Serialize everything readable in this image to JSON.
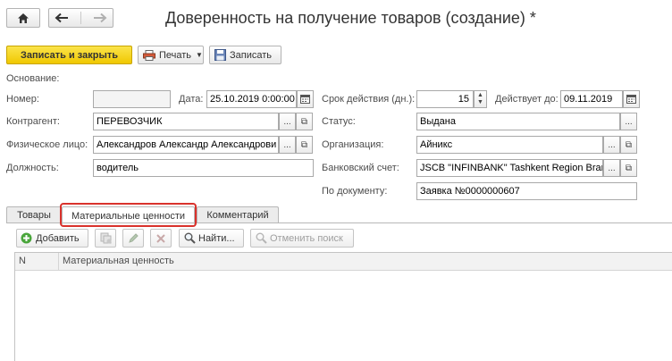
{
  "window": {
    "title": "Доверенность на получение товаров (создание) *"
  },
  "toolbar": {
    "save_close_label": "Записать и закрыть",
    "print_label": "Печать",
    "save_label": "Записать"
  },
  "form": {
    "basis_label": "Основание:",
    "number_label": "Номер:",
    "number_value": "",
    "date_label": "Дата:",
    "date_value": "25.10.2019  0:00:00",
    "validity_label": "Срок действия (дн.):",
    "validity_value": "15",
    "valid_until_label": "Действует до:",
    "valid_until_value": "09.11.2019",
    "counterparty_label": "Контрагент:",
    "counterparty_value": "ПЕРЕВОЗЧИК",
    "status_label": "Статус:",
    "status_value": "Выдана",
    "person_label": "Физическое лицо:",
    "person_value": "Александров Александр Александрови",
    "organization_label": "Организация:",
    "organization_value": "Айникс",
    "position_label": "Должность:",
    "position_value": "водитель",
    "bank_account_label": "Банковский счет:",
    "bank_account_value": "JSCB \"INFINBANK\" Tashkent Region Brar",
    "document_label": "По документу:",
    "document_value": "Заявка №0000000607",
    "ellipsis": "...",
    "open_glyph": "⧉"
  },
  "tabs": [
    {
      "label": "Товары"
    },
    {
      "label": "Материальные ценности"
    },
    {
      "label": "Комментарий"
    }
  ],
  "table_toolbar": {
    "add_label": "Добавить",
    "find_label": "Найти...",
    "cancel_search_label": "Отменить поиск"
  },
  "table": {
    "columns": [
      "N",
      "Материальная ценность"
    ]
  },
  "colors": {
    "accent_yellow": "#f7d51d",
    "highlight_red": "#d9322c"
  },
  "icons": [
    "home-icon",
    "arrow-left-icon",
    "arrow-right-icon",
    "printer-icon",
    "floppy-icon",
    "calendar-icon",
    "add-icon",
    "copy-icon",
    "pencil-icon",
    "delete-icon",
    "search-icon",
    "cancel-search-icon"
  ]
}
